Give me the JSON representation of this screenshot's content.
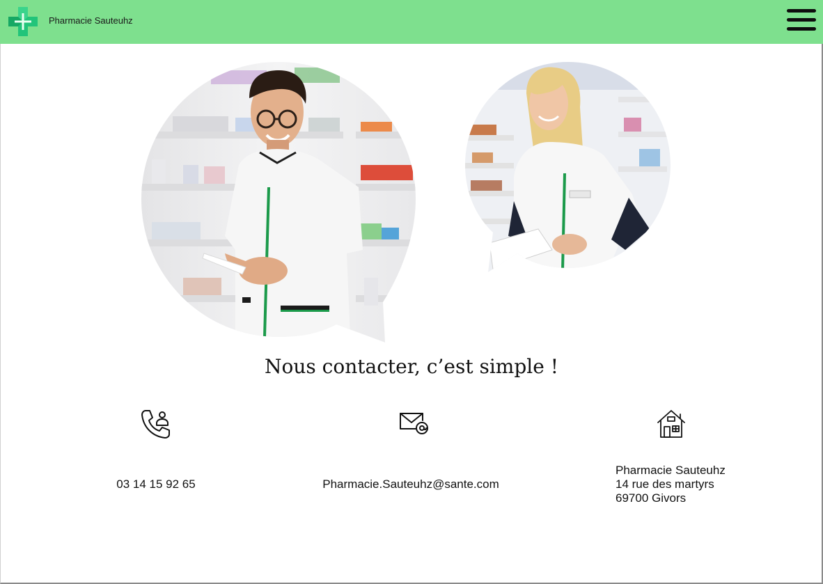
{
  "header": {
    "brand": "Pharmacie Sauteuhz",
    "logo_icon": "pharmacy-cross-icon",
    "menu_icon": "hamburger-menu-icon",
    "background_color": "#7ee08e"
  },
  "photos": [
    {
      "name": "pharmacist-man-photo"
    },
    {
      "name": "pharmacist-woman-photo"
    }
  ],
  "main": {
    "title": "Nous contacter, c’est simple !"
  },
  "contacts": {
    "phone": {
      "icon": "phone-icon",
      "value": "03 14 15 92 65"
    },
    "email": {
      "icon": "email-icon",
      "value": "Pharmacie.Sauteuhz@sante.com"
    },
    "address": {
      "icon": "house-icon",
      "line1": "Pharmacie Sauteuhz",
      "line2": "14 rue des martyrs",
      "line3": "69700 Givors"
    }
  }
}
